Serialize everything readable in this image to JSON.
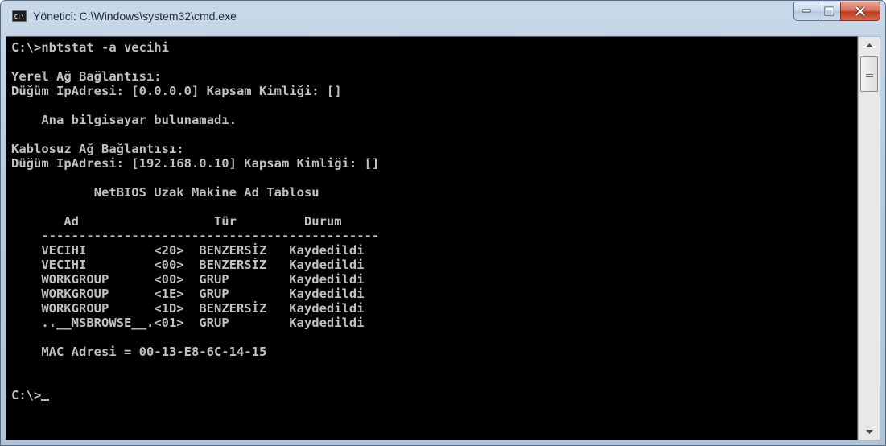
{
  "window": {
    "title": "Yönetici: C:\\Windows\\system32\\cmd.exe",
    "icon_text": "C:\\",
    "controls": {
      "minimize_icon": "minimize-icon",
      "maximize_icon": "maximize-icon",
      "close_icon": "close-icon"
    }
  },
  "console": {
    "text_color": "#c0c0c0",
    "background": "#000000",
    "lines": [
      "C:\\>nbtstat -a vecihi",
      "",
      "Yerel Ağ Bağlantısı:",
      "Düğüm IpAdresi: [0.0.0.0] Kapsam Kimliği: []",
      "",
      "    Ana bilgisayar bulunamadı.",
      "",
      "Kablosuz Ağ Bağlantısı:",
      "Düğüm IpAdresi: [192.168.0.10] Kapsam Kimliği: []",
      "",
      "           NetBIOS Uzak Makine Ad Tablosu",
      "",
      "       Ad                  Tür         Durum",
      "    ---------------------------------------------",
      "    VECIHI         <20>  BENZERSİZ   Kaydedildi",
      "    VECIHI         <00>  BENZERSİZ   Kaydedildi",
      "    WORKGROUP      <00>  GRUP        Kaydedildi",
      "    WORKGROUP      <1E>  GRUP        Kaydedildi",
      "    WORKGROUP      <1D>  BENZERSİZ   Kaydedildi",
      "    ..__MSBROWSE__.<01>  GRUP        Kaydedildi",
      "",
      "    MAC Adresi = 00-13-E8-6C-14-15",
      "",
      "",
      "C:\\>"
    ]
  },
  "scrollbar": {
    "up_icon": "scroll-up-arrow-icon",
    "down_icon": "scroll-down-arrow-icon"
  }
}
